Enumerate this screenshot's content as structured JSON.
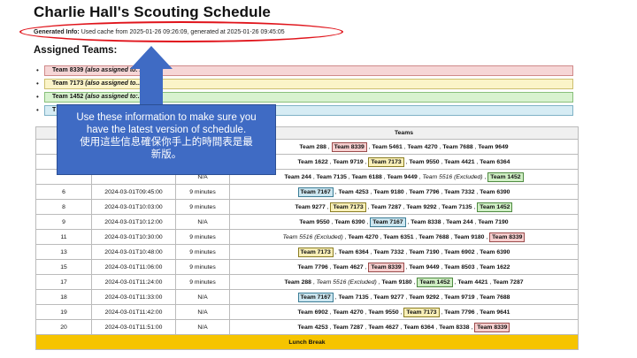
{
  "title": "Charlie Hall's Scouting Schedule",
  "generated_info": {
    "label": "Generated Info:",
    "text": "Used cache from 2025-01-26 09:26:09, generated at 2025-01-26 09:45:05"
  },
  "assigned_heading": "Assigned Teams:",
  "assigned_teams": [
    {
      "team": "Team 8339",
      "note": "(also assigned to: Al...rter)",
      "color": "red"
    },
    {
      "team": "Team 7173",
      "note": "(also assigned to...",
      "color": "yellow"
    },
    {
      "team": "Team 1452",
      "note": "(also assigned to:...rter)",
      "color": "green"
    },
    {
      "team": "T",
      "note": "",
      "color": "blue"
    }
  ],
  "table": {
    "headers": [
      "M",
      "",
      "",
      "Teams"
    ],
    "rows": [
      {
        "match": "",
        "time": "",
        "duration": "",
        "teams": [
          {
            "t": "Team 288"
          },
          {
            "t": "Team 8339",
            "hl": "red"
          },
          {
            "t": "Team 5461"
          },
          {
            "t": "Team 4270"
          },
          {
            "t": "Team 7688"
          },
          {
            "t": "Team 9649"
          }
        ]
      },
      {
        "match": "",
        "time": "",
        "duration": "",
        "teams": [
          {
            "t": "Team 1622"
          },
          {
            "t": "Team 9719"
          },
          {
            "t": "Team 7173",
            "hl": "yellow"
          },
          {
            "t": "Team 9550"
          },
          {
            "t": "Team 4421"
          },
          {
            "t": "Team 6364"
          }
        ]
      },
      {
        "match": "",
        "time": "",
        "duration": "N/A",
        "teams": [
          {
            "t": "Team 244"
          },
          {
            "t": "Team 7135"
          },
          {
            "t": "Team 6188"
          },
          {
            "t": "Team 9449"
          },
          {
            "t": "Team 5516 (Excluded)",
            "ex": true
          },
          {
            "t": "Team 1452",
            "hl": "green"
          }
        ]
      },
      {
        "match": "6",
        "time": "2024-03-01T09:45:00",
        "duration": "9 minutes",
        "teams": [
          {
            "t": "Team 7167",
            "hl": "blue"
          },
          {
            "t": "Team 4253"
          },
          {
            "t": "Team 9180"
          },
          {
            "t": "Team 7796"
          },
          {
            "t": "Team 7332"
          },
          {
            "t": "Team 6390"
          }
        ]
      },
      {
        "match": "8",
        "time": "2024-03-01T10:03:00",
        "duration": "9 minutes",
        "teams": [
          {
            "t": "Team 9277"
          },
          {
            "t": "Team 7173",
            "hl": "yellow"
          },
          {
            "t": "Team 7287"
          },
          {
            "t": "Team 9292"
          },
          {
            "t": "Team 7135"
          },
          {
            "t": "Team 1452",
            "hl": "green"
          }
        ]
      },
      {
        "match": "9",
        "time": "2024-03-01T10:12:00",
        "duration": "N/A",
        "teams": [
          {
            "t": "Team 9550"
          },
          {
            "t": "Team 6390"
          },
          {
            "t": "Team 7167",
            "hl": "blue"
          },
          {
            "t": "Team 8338"
          },
          {
            "t": "Team 244"
          },
          {
            "t": "Team 7190"
          }
        ]
      },
      {
        "match": "11",
        "time": "2024-03-01T10:30:00",
        "duration": "9 minutes",
        "teams": [
          {
            "t": "Team 5516 (Excluded)",
            "ex": true
          },
          {
            "t": "Team 4270"
          },
          {
            "t": "Team 6351"
          },
          {
            "t": "Team 7688"
          },
          {
            "t": "Team 9180"
          },
          {
            "t": "Team 8339",
            "hl": "red"
          }
        ]
      },
      {
        "match": "13",
        "time": "2024-03-01T10:48:00",
        "duration": "9 minutes",
        "teams": [
          {
            "t": "Team 7173",
            "hl": "yellow"
          },
          {
            "t": "Team 6364"
          },
          {
            "t": "Team 7332"
          },
          {
            "t": "Team 7190"
          },
          {
            "t": "Team 6902"
          },
          {
            "t": "Team 6390"
          }
        ]
      },
      {
        "match": "15",
        "time": "2024-03-01T11:06:00",
        "duration": "9 minutes",
        "teams": [
          {
            "t": "Team 7796"
          },
          {
            "t": "Team 4627"
          },
          {
            "t": "Team 8339",
            "hl": "red"
          },
          {
            "t": "Team 9449"
          },
          {
            "t": "Team 8503"
          },
          {
            "t": "Team 1622"
          }
        ]
      },
      {
        "match": "17",
        "time": "2024-03-01T11:24:00",
        "duration": "9 minutes",
        "teams": [
          {
            "t": "Team 288"
          },
          {
            "t": "Team 5516 (Excluded)",
            "ex": true
          },
          {
            "t": "Team 9180"
          },
          {
            "t": "Team 1452",
            "hl": "green"
          },
          {
            "t": "Team 4421"
          },
          {
            "t": "Team 7287"
          }
        ]
      },
      {
        "match": "18",
        "time": "2024-03-01T11:33:00",
        "duration": "N/A",
        "teams": [
          {
            "t": "Team 7167",
            "hl": "blue"
          },
          {
            "t": "Team 7135"
          },
          {
            "t": "Team 9277"
          },
          {
            "t": "Team 9292"
          },
          {
            "t": "Team 9719"
          },
          {
            "t": "Team 7688"
          }
        ]
      },
      {
        "match": "19",
        "time": "2024-03-01T11:42:00",
        "duration": "N/A",
        "teams": [
          {
            "t": "Team 6902"
          },
          {
            "t": "Team 4270"
          },
          {
            "t": "Team 9550"
          },
          {
            "t": "Team 7173",
            "hl": "yellow"
          },
          {
            "t": "Team 7796"
          },
          {
            "t": "Team 9641"
          }
        ]
      },
      {
        "match": "20",
        "time": "2024-03-01T11:51:00",
        "duration": "N/A",
        "teams": [
          {
            "t": "Team 4253"
          },
          {
            "t": "Team 7287"
          },
          {
            "t": "Team 4627"
          },
          {
            "t": "Team 6364"
          },
          {
            "t": "Team 8338"
          },
          {
            "t": "Team 8339",
            "hl": "red"
          }
        ]
      }
    ],
    "lunch_label": "Lunch Break"
  },
  "callout": {
    "line1": "Use these information to make sure you",
    "line2": "have the latest version of schedule.",
    "line3": "使用這些信息確保你手上的時間表是最",
    "line4": "新版。"
  },
  "colors": {
    "callout": "#3f6bc4",
    "ellipse": "#e0141b",
    "lunch": "#f6c400"
  }
}
